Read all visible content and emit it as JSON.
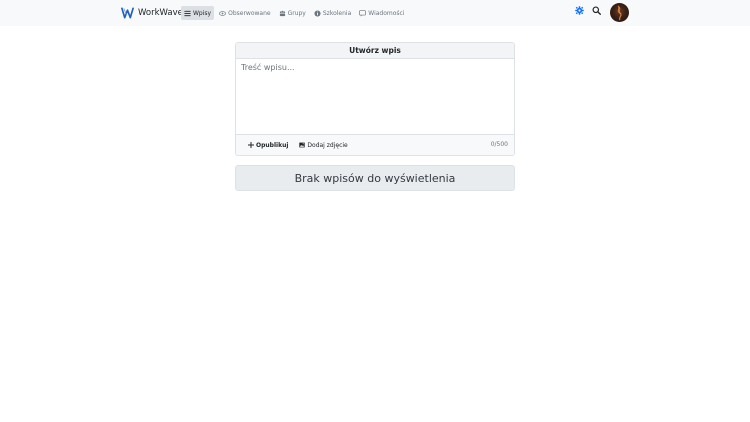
{
  "brand": {
    "name": "WorkWave"
  },
  "nav": {
    "items": [
      {
        "label": "Wpisy",
        "icon": "list-icon",
        "active": true
      },
      {
        "label": "Obserwowane",
        "icon": "eye-icon",
        "active": false
      },
      {
        "label": "Grupy",
        "icon": "users-icon",
        "active": false
      },
      {
        "label": "Szkolenia",
        "icon": "info-icon",
        "active": false
      },
      {
        "label": "Wiadomości",
        "icon": "message-icon",
        "active": false
      }
    ]
  },
  "composer": {
    "title": "Utwórz wpis",
    "placeholder": "Treść wpisu...",
    "publish_label": "Opublikuj",
    "photo_label": "Dodaj zdjęcie",
    "counter": "0/500"
  },
  "feed": {
    "empty_message": "Brak wpisów do wyświetlenia"
  },
  "colors": {
    "accent": "#0d6efd",
    "navbar_bg": "#f8f9fa",
    "active_nav_bg": "#dcdfe3"
  }
}
